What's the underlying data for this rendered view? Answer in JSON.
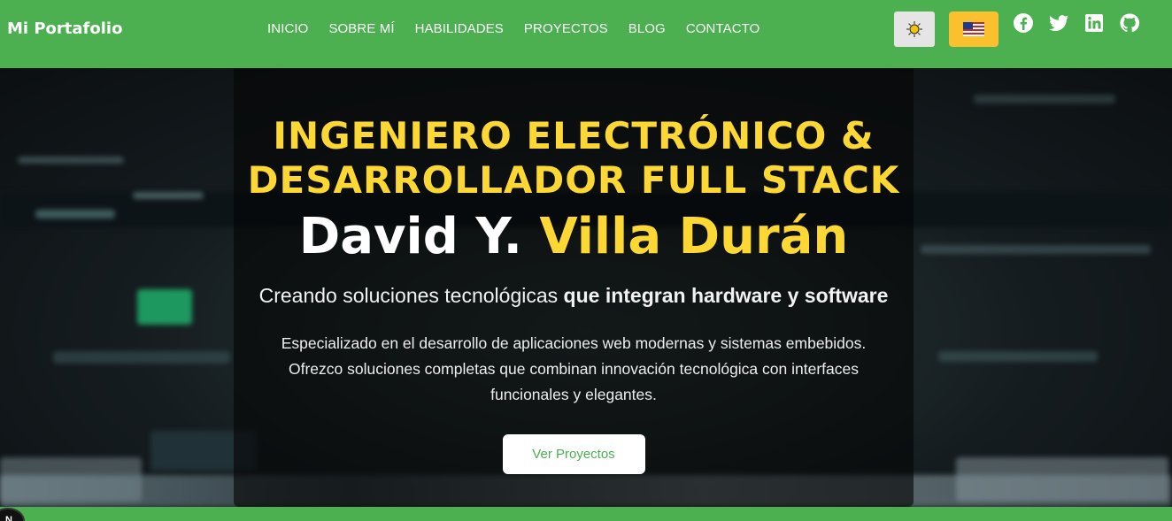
{
  "navbar": {
    "brand": "Mi Portafolio",
    "links": [
      "INICIO",
      "SOBRE MÍ",
      "HABILIDADES",
      "PROYECTOS",
      "BLOG",
      "CONTACTO"
    ],
    "theme_icon": "sun-icon",
    "language_icon": "us-flag-icon",
    "socials": [
      "facebook-icon",
      "twitter-icon",
      "linkedin-icon",
      "github-icon"
    ]
  },
  "hero": {
    "headline_line1": "INGENIERO ELECTRÓNICO &",
    "headline_line2": "DESARROLLADOR FULL STACK",
    "name_first": "David Y.",
    "name_last": "Villa Durán",
    "tagline_light": "Creando soluciones tecnológicas",
    "tagline_bold": "que integran hardware y software",
    "description_line1": "Especializado en el desarrollo de aplicaciones web modernas y sistemas embebidos.",
    "description_line2": "Ofrezco soluciones completas que combinan innovación tecnológica con interfaces",
    "description_line3": "funcionales y elegantes.",
    "cta_label": "Ver Proyectos"
  },
  "colors": {
    "primary": "#4caf50",
    "accent": "#fdd835"
  }
}
